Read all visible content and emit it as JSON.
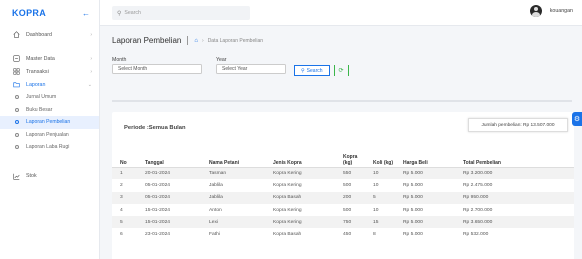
{
  "app": {
    "brand": "KOPRA"
  },
  "sidebar": {
    "items": [
      {
        "label": "Dashboard",
        "icon": "home-icon"
      },
      {
        "label": "Master Data",
        "icon": "database-icon"
      },
      {
        "label": "Transaksi",
        "icon": "grid-icon"
      },
      {
        "label": "Laporan",
        "icon": "folder-icon"
      }
    ],
    "sub_items": [
      {
        "label": "Jurnal Umum"
      },
      {
        "label": "Buku Besar"
      },
      {
        "label": "Laporan Pembelian"
      },
      {
        "label": "Laporan Penjualan"
      },
      {
        "label": "Laporan Laba Rugi"
      }
    ],
    "stok": {
      "label": "Stok",
      "icon": "chart-icon"
    }
  },
  "topbar": {
    "search_placeholder": "Search",
    "user_name": "kouangan"
  },
  "header": {
    "title": "Laporan Pembelian",
    "breadcrumb": "Data Laporan Pembelian"
  },
  "filters": {
    "month_label": "Month",
    "month_value": "Select Month",
    "year_label": "Year",
    "year_value": "Select Year",
    "search_label": "Search"
  },
  "card": {
    "title": "Periode :Semua Bulan",
    "total_text": "Jumlah pembelian: Rp 13.507.000"
  },
  "table": {
    "headers": [
      "No",
      "Tanggal",
      "Nama Petani",
      "Jenis Kopra",
      "Kopra (kg)",
      "Koli (kg)",
      "Harga Beli",
      "Total Pembelian"
    ],
    "rows": [
      [
        "1",
        "20-01-2024",
        "Tasman",
        "Kopra Kering",
        "550",
        "10",
        "Rp 5.000",
        "Rp 3.200.000"
      ],
      [
        "2",
        "05-01-2024",
        "Jablila",
        "Kopra Kering",
        "500",
        "10",
        "Rp 5.000",
        "Rp 2.475.000"
      ],
      [
        "3",
        "05-01-2024",
        "Jablila",
        "Kopra Basah",
        "200",
        "5",
        "Rp 5.000",
        "Rp 950.000"
      ],
      [
        "4",
        "15-01-2024",
        "Anton",
        "Kopra Kering",
        "500",
        "10",
        "Rp 5.000",
        "Rp 2.700.000"
      ],
      [
        "5",
        "15-01-2024",
        "Lexi",
        "Kopra Kering",
        "750",
        "15",
        "Rp 5.000",
        "Rp 3.650.000"
      ],
      [
        "6",
        "23-01-2024",
        "Fathi",
        "Kopra Basah",
        "450",
        "8",
        "Rp 5.000",
        "Rp 532.000"
      ]
    ]
  },
  "colors": {
    "accent": "#1a73e8",
    "refresh": "#3ab54a"
  }
}
